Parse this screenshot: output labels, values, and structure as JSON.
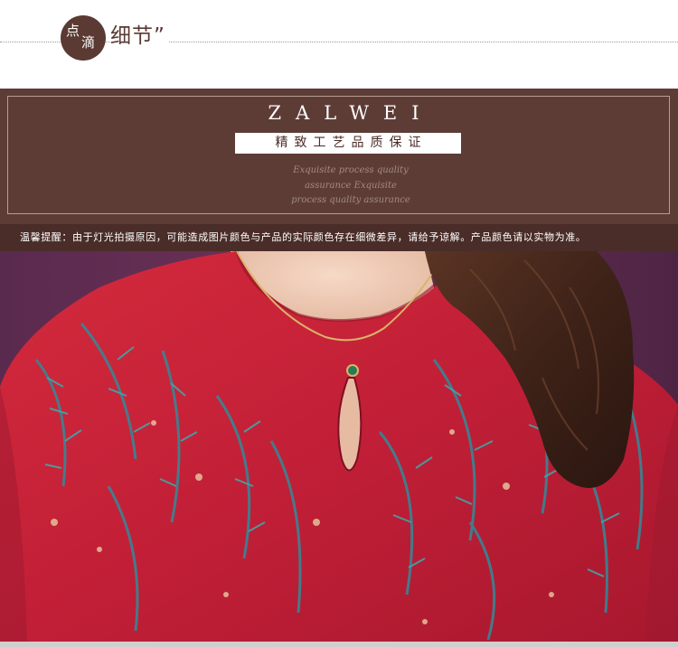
{
  "header": {
    "badge_char_1": "点",
    "badge_char_2": "滴",
    "title": "细节”"
  },
  "banner": {
    "brand": "ZALWEI",
    "quality_text": "精致工艺品质保证",
    "script_lines": [
      "Exquisite process quality",
      "assurance Exquisite",
      "process quality assurance"
    ]
  },
  "notice": {
    "text": "温馨提醒：由于灯光拍摄原因，可能造成图片颜色与产品的实际颜色存在细微差异，请给予谅解。产品颜色请以实物为准。"
  },
  "colors": {
    "brown": "#5e3c36",
    "dark_brown": "#4a2d28",
    "badge": "#5a3a33",
    "dress_red": "#c4213a",
    "leaf_teal": "#2f8c9a",
    "background_purple": "#6b2f54"
  }
}
